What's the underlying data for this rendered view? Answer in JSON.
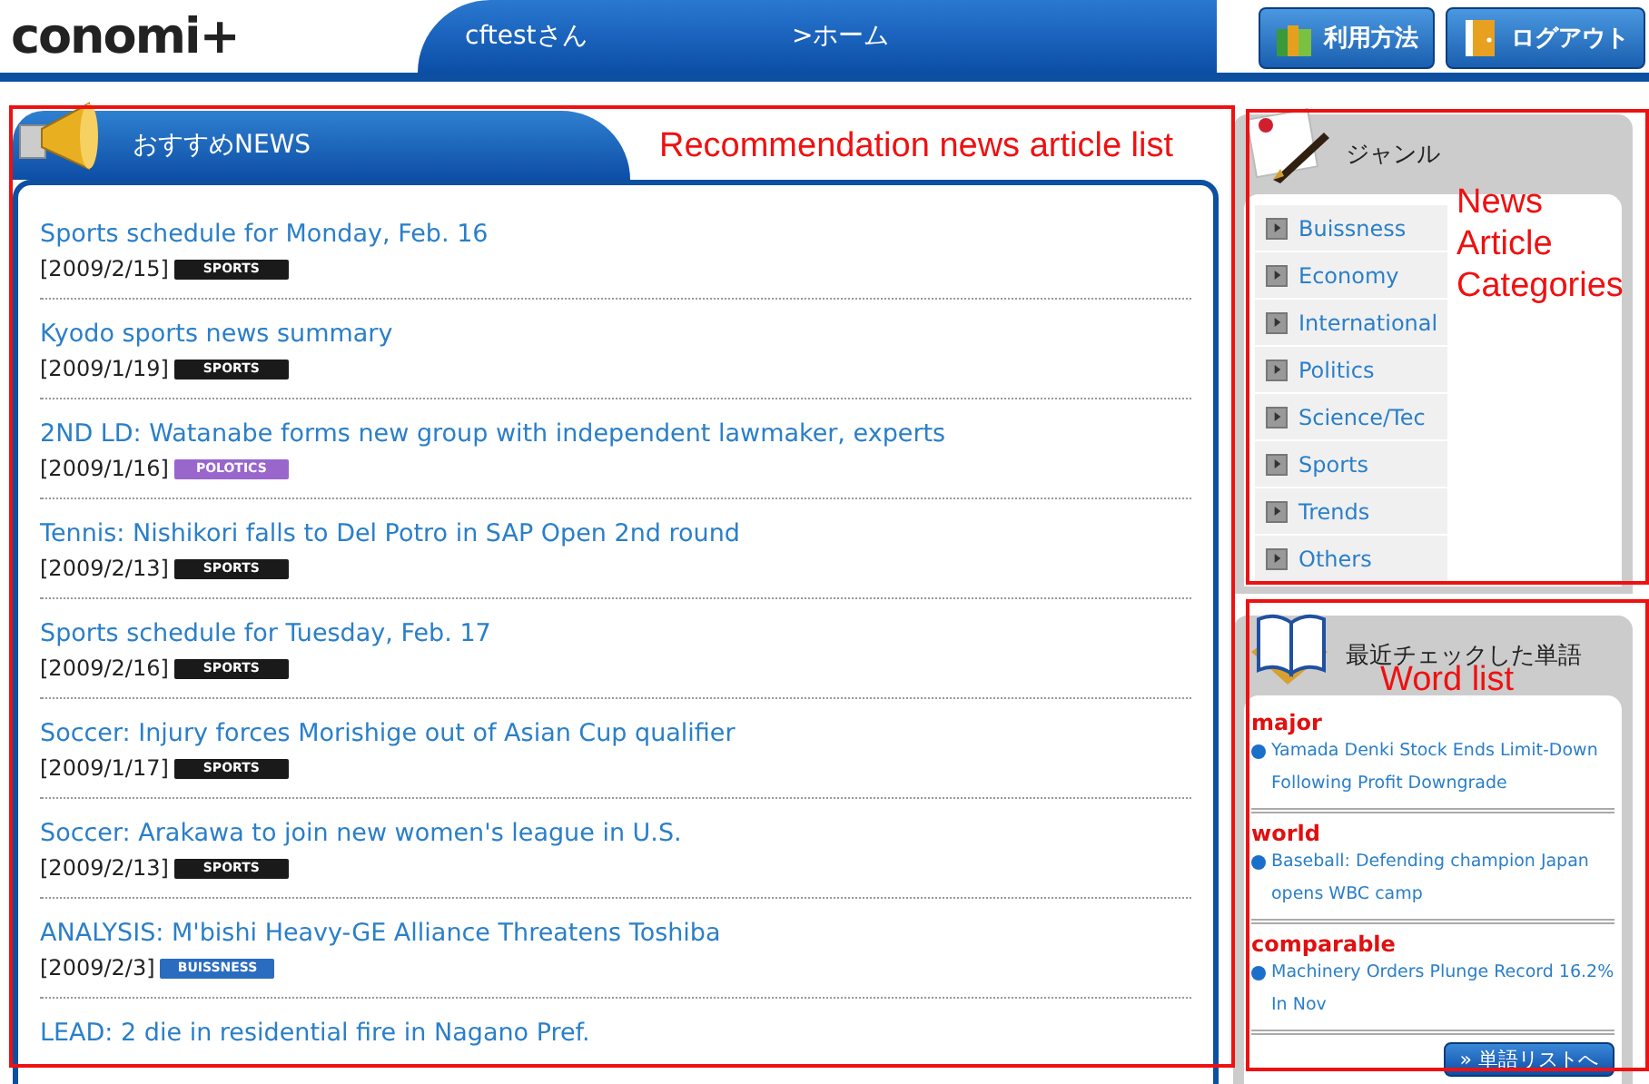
{
  "header": {
    "logo": "conomi+",
    "user": "cftestさん",
    "breadcrumb": ">ホーム",
    "buttons": [
      {
        "kind": "help",
        "label": "利用方法"
      },
      {
        "kind": "logout",
        "label": "ログアウト"
      }
    ]
  },
  "news": {
    "title": "おすすめNEWS",
    "items": [
      {
        "title": "Sports schedule for Monday, Feb. 16",
        "date": "[2009/2/15]",
        "tag": "SPORTS",
        "color": "#1a1a1a"
      },
      {
        "title": "Kyodo sports news summary",
        "date": "[2009/1/19]",
        "tag": "SPORTS",
        "color": "#1a1a1a"
      },
      {
        "title": "2ND LD: Watanabe forms new group with independent lawmaker, experts",
        "date": "[2009/1/16]",
        "tag": "POLOTICS",
        "color": "#9966cc"
      },
      {
        "title": "Tennis: Nishikori falls to Del Potro in SAP Open 2nd round",
        "date": "[2009/2/13]",
        "tag": "SPORTS",
        "color": "#1a1a1a"
      },
      {
        "title": "Sports schedule for Tuesday, Feb. 17",
        "date": "[2009/2/16]",
        "tag": "SPORTS",
        "color": "#1a1a1a"
      },
      {
        "title": "Soccer: Injury forces Morishige out of Asian Cup qualifier",
        "date": "[2009/1/17]",
        "tag": "SPORTS",
        "color": "#1a1a1a"
      },
      {
        "title": "Soccer: Arakawa to join new women's league in U.S.",
        "date": "[2009/2/13]",
        "tag": "SPORTS",
        "color": "#1a1a1a"
      },
      {
        "title": "ANALYSIS: M'bishi Heavy-GE Alliance Threatens Toshiba",
        "date": "[2009/2/3]",
        "tag": "BUISSNESS",
        "color": "#2a6cc0"
      },
      {
        "title": "LEAD: 2 die in residential fire in Nagano Pref."
      }
    ]
  },
  "genres": {
    "title": "ジャンル",
    "items": [
      "Buissness",
      "Economy",
      "International",
      "Politics",
      "Science/Tec",
      "Sports",
      "Trends",
      "Others"
    ]
  },
  "words": {
    "title": "最近チェックした単語",
    "items": [
      {
        "word": "major",
        "article": "Yamada Denki Stock Ends Limit-Down Following Profit Downgrade"
      },
      {
        "word": "world",
        "article": "Baseball: Defending champion Japan opens WBC camp"
      },
      {
        "word": "comparable",
        "article": "Machinery Orders Plunge Record 16.2% In Nov"
      }
    ],
    "button": "» 単語リストへ"
  },
  "annotations": [
    {
      "kind": "news",
      "label": "Recommendation news article list"
    },
    {
      "kind": "genres",
      "label": "News Article Categories"
    },
    {
      "kind": "words",
      "label": "Word list"
    }
  ]
}
